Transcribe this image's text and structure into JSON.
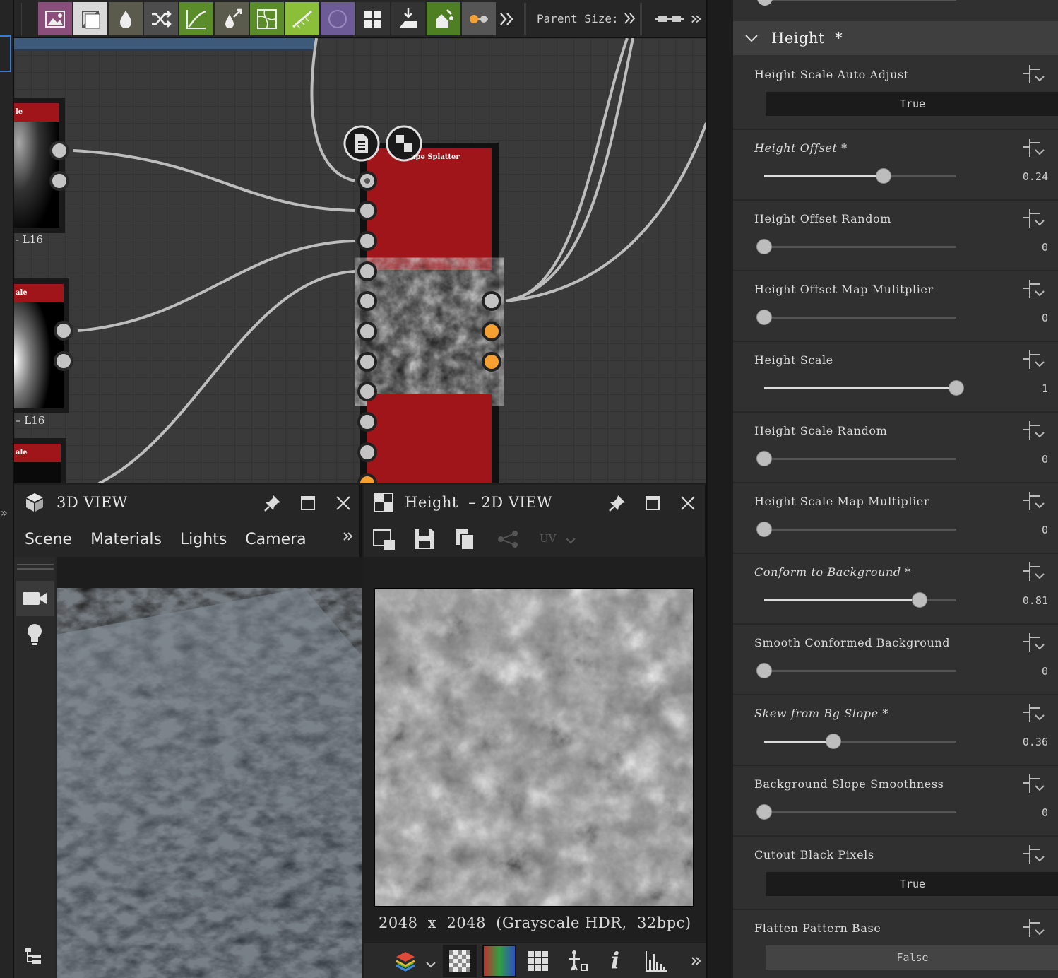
{
  "toolbar": {
    "parent_size_label": "Parent Size:",
    "buttons": [
      {
        "icon": "image-icon",
        "color": "#8a4e7a"
      },
      {
        "icon": "uniform-color-icon",
        "color": "#d9d9d9"
      },
      {
        "icon": "water-drop-icon",
        "color": "#5b5b4d"
      },
      {
        "icon": "shuffle-icon",
        "color": "#4d4d4d"
      },
      {
        "icon": "curve-icon",
        "color": "#5a8c2a"
      },
      {
        "icon": "dropper-icon",
        "color": "#5b5b4d"
      },
      {
        "icon": "warp-icon",
        "color": "#5a8c2a"
      },
      {
        "icon": "gradient-ramp-icon",
        "color": "#8bbf3a"
      },
      {
        "icon": "circle-icon",
        "color": "#6c5b96"
      },
      {
        "icon": "grid-icon",
        "color": "#333333"
      },
      {
        "icon": "import-icon",
        "color": "#333333"
      },
      {
        "icon": "paint-icon",
        "color": "#4f7f23"
      },
      {
        "icon": "slider-icon",
        "color": "#555555"
      }
    ]
  },
  "graph": {
    "node_main_title": "ape Splatter",
    "node_left1_title": "le",
    "node_left1_label": "- L16",
    "node_left2_title": "ale",
    "node_left2_label": "– L16",
    "node_left3_title": "ale",
    "accent_red": "#a0151a",
    "socket_orange": "#f5a030"
  },
  "view3d": {
    "title": "3D VIEW",
    "tabs": [
      "Scene",
      "Materials",
      "Lights",
      "Camera"
    ]
  },
  "view2d": {
    "title": "Height  – 2D VIEW",
    "uv_label": "UV",
    "info": "2048  x  2048  (Grayscale HDR,  32bpc)"
  },
  "properties": {
    "section_title": "Height  *",
    "items": [
      {
        "label": "Height Scale Auto Adjust",
        "kind": "toggle",
        "value": "True",
        "modified": false
      },
      {
        "label": "Height Offset *",
        "kind": "slider",
        "value": "0.24",
        "fraction": 0.62,
        "modified": true
      },
      {
        "label": "Height Offset Random",
        "kind": "slider",
        "value": "0",
        "fraction": 0.0,
        "modified": false
      },
      {
        "label": "Height Offset Map Mulitplier",
        "kind": "slider",
        "value": "0",
        "fraction": 0.0,
        "modified": false
      },
      {
        "label": "Height Scale",
        "kind": "slider",
        "value": "1",
        "fraction": 1.0,
        "modified": false
      },
      {
        "label": "Height Scale Random",
        "kind": "slider",
        "value": "0",
        "fraction": 0.0,
        "modified": false
      },
      {
        "label": "Height Scale Map Multiplier",
        "kind": "slider",
        "value": "0",
        "fraction": 0.0,
        "modified": false
      },
      {
        "label": "Conform to Background *",
        "kind": "slider",
        "value": "0.81",
        "fraction": 0.81,
        "modified": true
      },
      {
        "label": "Smooth Conformed Background",
        "kind": "slider",
        "value": "0",
        "fraction": 0.0,
        "modified": false
      },
      {
        "label": "Skew from Bg Slope *",
        "kind": "slider",
        "value": "0.36",
        "fraction": 0.36,
        "modified": true
      },
      {
        "label": "Background Slope Smoothness",
        "kind": "slider",
        "value": "0",
        "fraction": 0.0,
        "modified": false
      },
      {
        "label": "Cutout Black Pixels",
        "kind": "toggle",
        "value": "True",
        "modified": false
      },
      {
        "label": "Flatten Pattern Base",
        "kind": "toggle",
        "value": "False",
        "modified": false
      }
    ]
  }
}
